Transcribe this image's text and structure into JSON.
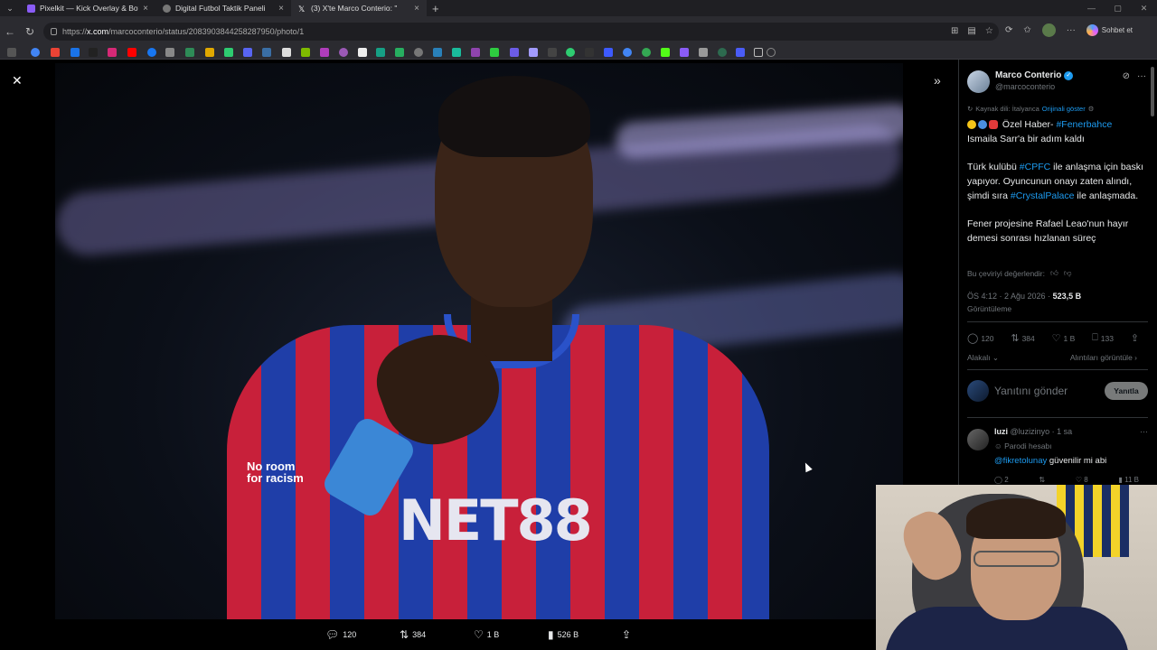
{
  "browser": {
    "tabs": [
      {
        "title": "Pixelkit — Kick Overlay & Bot",
        "favicon_color": "#8a5cf6"
      },
      {
        "title": "Digital Futbol Taktik Paneli",
        "favicon_color": "#cccccc"
      },
      {
        "title": "(3) X'te Marco Conterio: \"",
        "favicon_color": "#ffffff"
      }
    ],
    "url_host": "x.com",
    "url_path": "/marcoconterio/status/2083903844258287950/photo/1",
    "url_prefix": "https://",
    "chat_label": "Sohbet et"
  },
  "viewer": {
    "sponsor_text": "NET88",
    "badge_text": "No room for racism",
    "actions": {
      "replies": "120",
      "reposts": "384",
      "likes": "1 B",
      "views": "526 B"
    }
  },
  "tweet": {
    "author_name": "Marco Conterio",
    "author_handle": "@marcoconterio",
    "source_lang": "Kaynak dili: İtalyanca",
    "show_original": "Orijinali göster",
    "headline_prefix": "Özel Haber-",
    "headline_tag": "#Fenerbahce",
    "headline_rest": "Ismaila Sarr'a bir adım kaldı",
    "p2_a": "Türk kulübü",
    "p2_tag1": "#CPFC",
    "p2_b": "ile anlaşma için baskı yapıyor. Oyuncunun onayı zaten alındı, şimdi sıra",
    "p2_tag2": "#CrystalPalace",
    "p2_c": "ile anlaşmada.",
    "p3": "Fener projesine Rafael Leao'nun hayır demesi sonrası hızlanan süreç",
    "rate_translation": "Bu çeviriyi değerlendir:",
    "time": "ÖS 4:12 · 2 Ağu 2026 ·",
    "views": "523,5 B",
    "views_label": "Görüntüleme",
    "stats": {
      "replies": "120",
      "reposts": "384",
      "likes": "1 B",
      "bookmarks": "133"
    },
    "related": "Alakalı",
    "quotes": "Alıntıları görüntüle",
    "reply_placeholder": "Yanıtını gönder",
    "reply_button": "Yanıtla"
  },
  "comment": {
    "name": "luzi",
    "handle": "@luzizinyo · 1 sa",
    "parody": "Parodi hesabı",
    "mention": "@fikretolunay",
    "text": "güvenilir mi abi",
    "stats": {
      "replies": "2",
      "likes": "8",
      "views": "11 B"
    }
  }
}
